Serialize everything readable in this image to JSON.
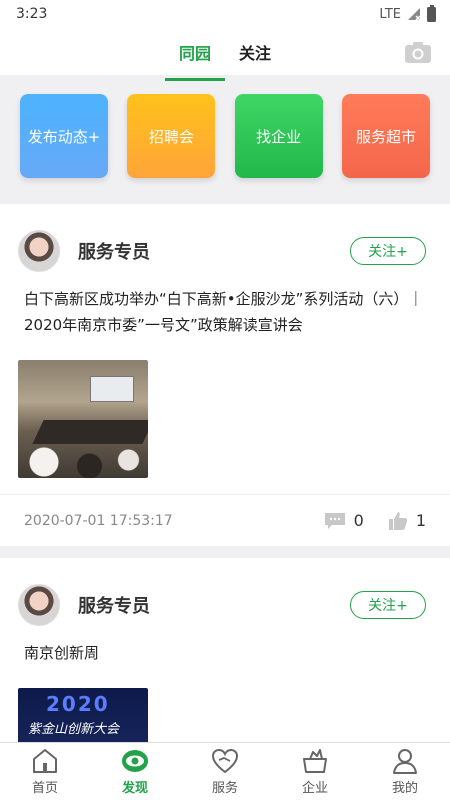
{
  "status_bar": {
    "time": "3:23",
    "network": "LTE"
  },
  "top_tabs": [
    {
      "label": "同园"
    },
    {
      "label": "关注"
    }
  ],
  "quick_actions": [
    {
      "label": "发布动态+"
    },
    {
      "label": "招聘会"
    },
    {
      "label": "找企业"
    },
    {
      "label": "服务超市"
    }
  ],
  "posts": [
    {
      "author": "服务专员",
      "follow_label": "关注+",
      "text": "白下高新区成功举办“白下高新•企服沙龙”系列活动（六）｜2020年南京市委”一号文”政策解读宣讲会",
      "timestamp": "2020-07-01 17:53:17",
      "comments": "0",
      "likes": "1"
    },
    {
      "author": "服务专员",
      "follow_label": "关注+",
      "text": "南京创新周",
      "image_text": {
        "year": "2020",
        "slogan": "紫金山创新大会"
      }
    }
  ],
  "bottom_nav": [
    {
      "label": "首页"
    },
    {
      "label": "发现"
    },
    {
      "label": "服务"
    },
    {
      "label": "企业"
    },
    {
      "label": "我的"
    }
  ],
  "colors": {
    "accent": "#22a24a"
  }
}
